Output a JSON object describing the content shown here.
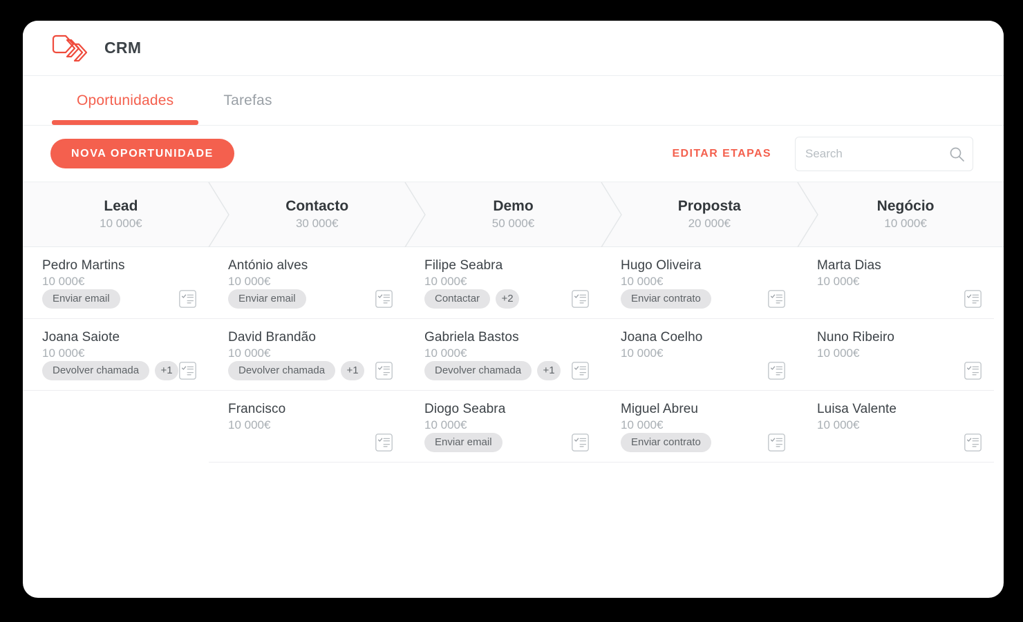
{
  "window": {
    "app_title": "CRM",
    "logo_icon": "chevron-stack-logo",
    "brand_color": "#f4604e"
  },
  "tabs": [
    {
      "label": "Oportunidades",
      "active": true
    },
    {
      "label": "Tarefas",
      "active": false
    }
  ],
  "toolbar": {
    "new_opportunity_label": "NOVA OPORTUNIDADE",
    "edit_stages_label": "EDITAR ETAPAS",
    "search": {
      "placeholder": "Search",
      "value": "",
      "icon": "search-icon"
    }
  },
  "pipeline": {
    "stages": [
      {
        "name": "Lead",
        "value": "10 000€",
        "bar_color": "#f47fd8"
      },
      {
        "name": "Contacto",
        "value": "30 000€",
        "bar_color": "#6275ef"
      },
      {
        "name": "Demo",
        "value": "50 000€",
        "bar_color": "#4d94f0"
      },
      {
        "name": "Proposta",
        "value": "20 000€",
        "bar_color": "#4ec5ad"
      },
      {
        "name": "Negócio",
        "value": "10 000€",
        "bar_color": ""
      }
    ]
  },
  "board": {
    "task_icon": "checklist-icon",
    "columns": [
      {
        "stage": "Lead",
        "cards": [
          {
            "name": "Pedro Martins",
            "value": "10 000€",
            "tag": "Enviar email",
            "more": ""
          },
          {
            "name": "Joana Saiote",
            "value": "10 000€",
            "tag": "Devolver chamada",
            "more": "+1"
          }
        ]
      },
      {
        "stage": "Contacto",
        "cards": [
          {
            "name": "António alves",
            "value": "10 000€",
            "tag": "Enviar email",
            "more": ""
          },
          {
            "name": "David Brandão",
            "value": "10 000€",
            "tag": "Devolver chamada",
            "more": "+1"
          },
          {
            "name": "Francisco",
            "value": "10 000€",
            "tag": "",
            "more": ""
          }
        ]
      },
      {
        "stage": "Demo",
        "cards": [
          {
            "name": "Filipe Seabra",
            "value": "10 000€",
            "tag": "Contactar",
            "more": "+2"
          },
          {
            "name": "Gabriela Bastos",
            "value": "10 000€",
            "tag": "Devolver chamada",
            "more": "+1"
          },
          {
            "name": "Diogo Seabra",
            "value": "10 000€",
            "tag": "Enviar email",
            "more": ""
          }
        ]
      },
      {
        "stage": "Proposta",
        "cards": [
          {
            "name": "Hugo Oliveira",
            "value": "10 000€",
            "tag": "Enviar contrato",
            "more": ""
          },
          {
            "name": "Joana Coelho",
            "value": "10 000€",
            "tag": "",
            "more": ""
          },
          {
            "name": "Miguel Abreu",
            "value": "10 000€",
            "tag": "Enviar contrato",
            "more": ""
          }
        ]
      },
      {
        "stage": "Negócio",
        "cards": [
          {
            "name": "Marta Dias",
            "value": "10 000€",
            "tag": "",
            "more": ""
          },
          {
            "name": "Nuno Ribeiro",
            "value": "10 000€",
            "tag": "",
            "more": ""
          },
          {
            "name": "Luisa Valente",
            "value": "10 000€",
            "tag": "",
            "more": ""
          }
        ]
      }
    ]
  }
}
